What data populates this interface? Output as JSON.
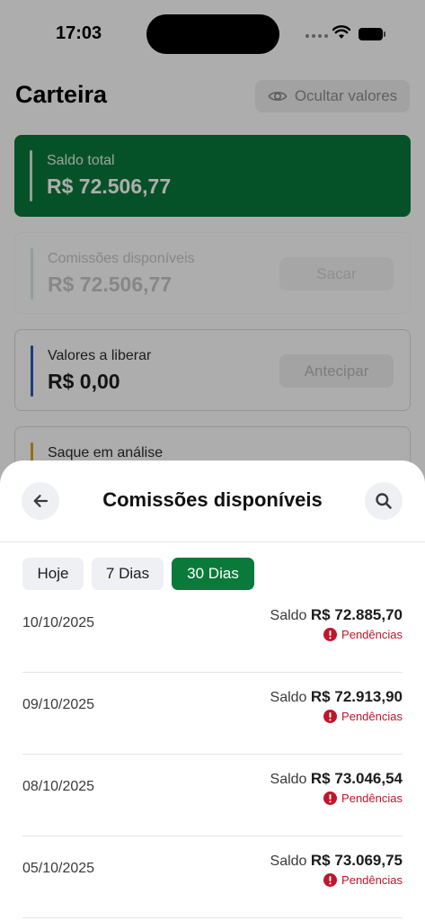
{
  "status_bar": {
    "time": "17:03"
  },
  "wallet": {
    "title": "Carteira",
    "hide_values_label": "Ocultar valores",
    "total": {
      "label": "Saldo total",
      "value": "R$ 72.506,77"
    },
    "commissions": {
      "label": "Comissões disponíveis",
      "value": "R$ 72.506,77",
      "action": "Sacar"
    },
    "release": {
      "label": "Valores a liberar",
      "value": "R$ 0,00",
      "action": "Antecipar"
    },
    "withdraw": {
      "label": "Saque em análise"
    }
  },
  "sheet": {
    "title": "Comissões disponíveis",
    "filters": [
      "Hoje",
      "7 Dias",
      "30 Dias"
    ],
    "selected_filter": "30 Dias",
    "balance_prefix": "Saldo",
    "rows": [
      {
        "date": "10/10/2025",
        "balance": "R$ 72.885,70",
        "status": "Pendências"
      },
      {
        "date": "09/10/2025",
        "balance": "R$ 72.913,90",
        "status": "Pendências"
      },
      {
        "date": "08/10/2025",
        "balance": "R$ 73.046,54",
        "status": "Pendências"
      },
      {
        "date": "05/10/2025",
        "balance": "R$ 73.069,75",
        "status": "Pendências"
      }
    ]
  },
  "colors": {
    "brand_green": "#0a7a3b",
    "pending_red": "#c0152a",
    "release_blue": "#2a5db5",
    "withdraw_amber": "#e0a11b"
  }
}
